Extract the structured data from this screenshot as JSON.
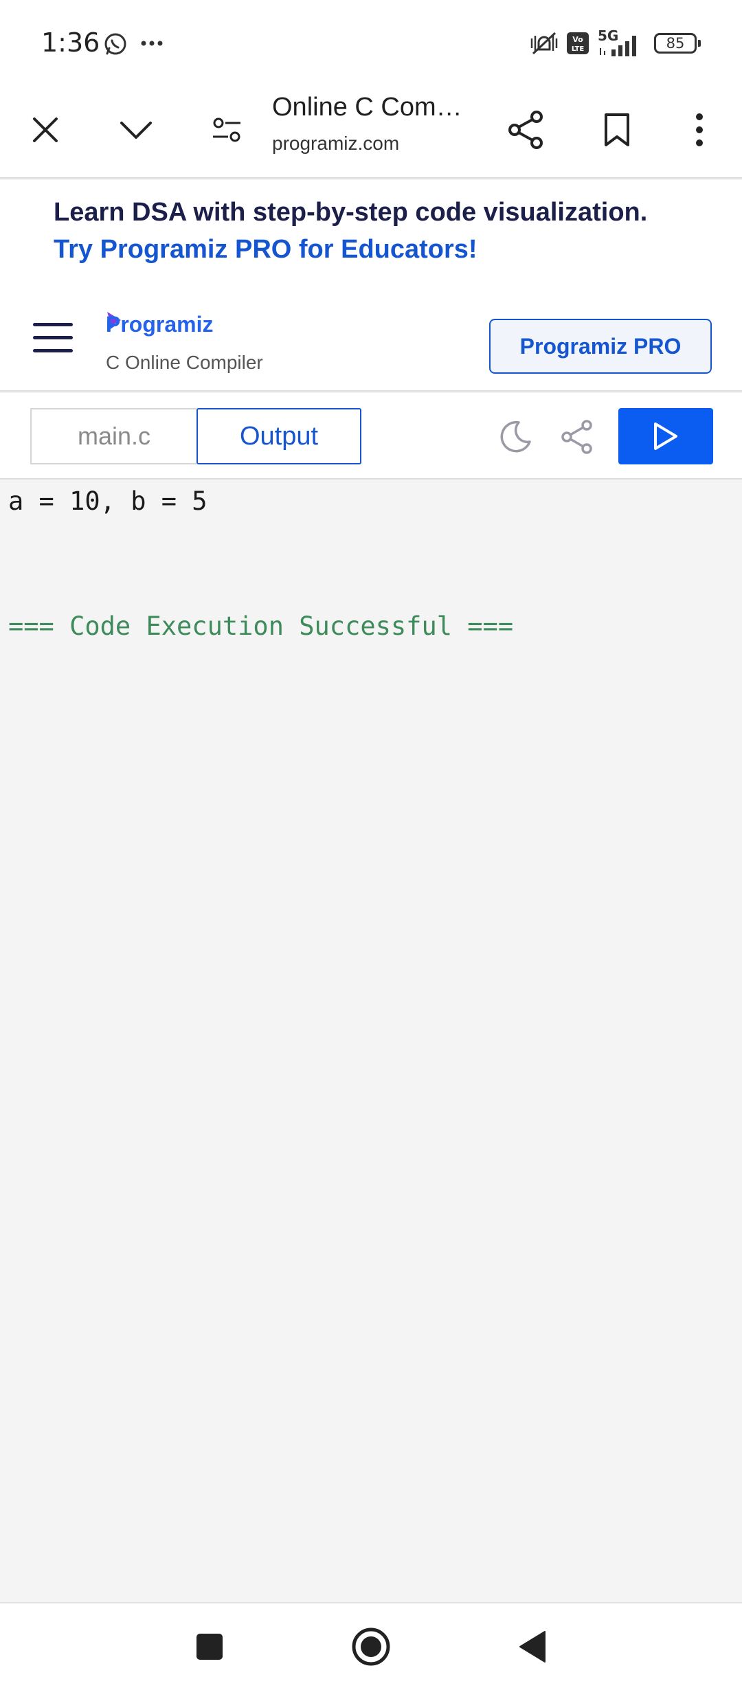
{
  "status_bar": {
    "time": "1:36",
    "network": "5G",
    "battery": "85"
  },
  "browser": {
    "page_title": "Online C Com…",
    "url": "programiz.com"
  },
  "banner": {
    "line1": "Learn DSA with step-by-step code visualization.",
    "line2": "Try Programiz PRO for Educators!"
  },
  "site_header": {
    "logo": "Programiz",
    "subtitle": "C Online Compiler",
    "pro_button": "Programiz PRO"
  },
  "editor": {
    "file_tab": "main.c",
    "output_tab": "Output"
  },
  "output": {
    "line1": "a = 10, b = 5",
    "status": "=== Code Execution Successful ==="
  },
  "colors": {
    "accent": "#1556d0",
    "run_button": "#0b5cf0",
    "success_text": "#3d8a5a",
    "banner_text": "#1c1f4a"
  }
}
